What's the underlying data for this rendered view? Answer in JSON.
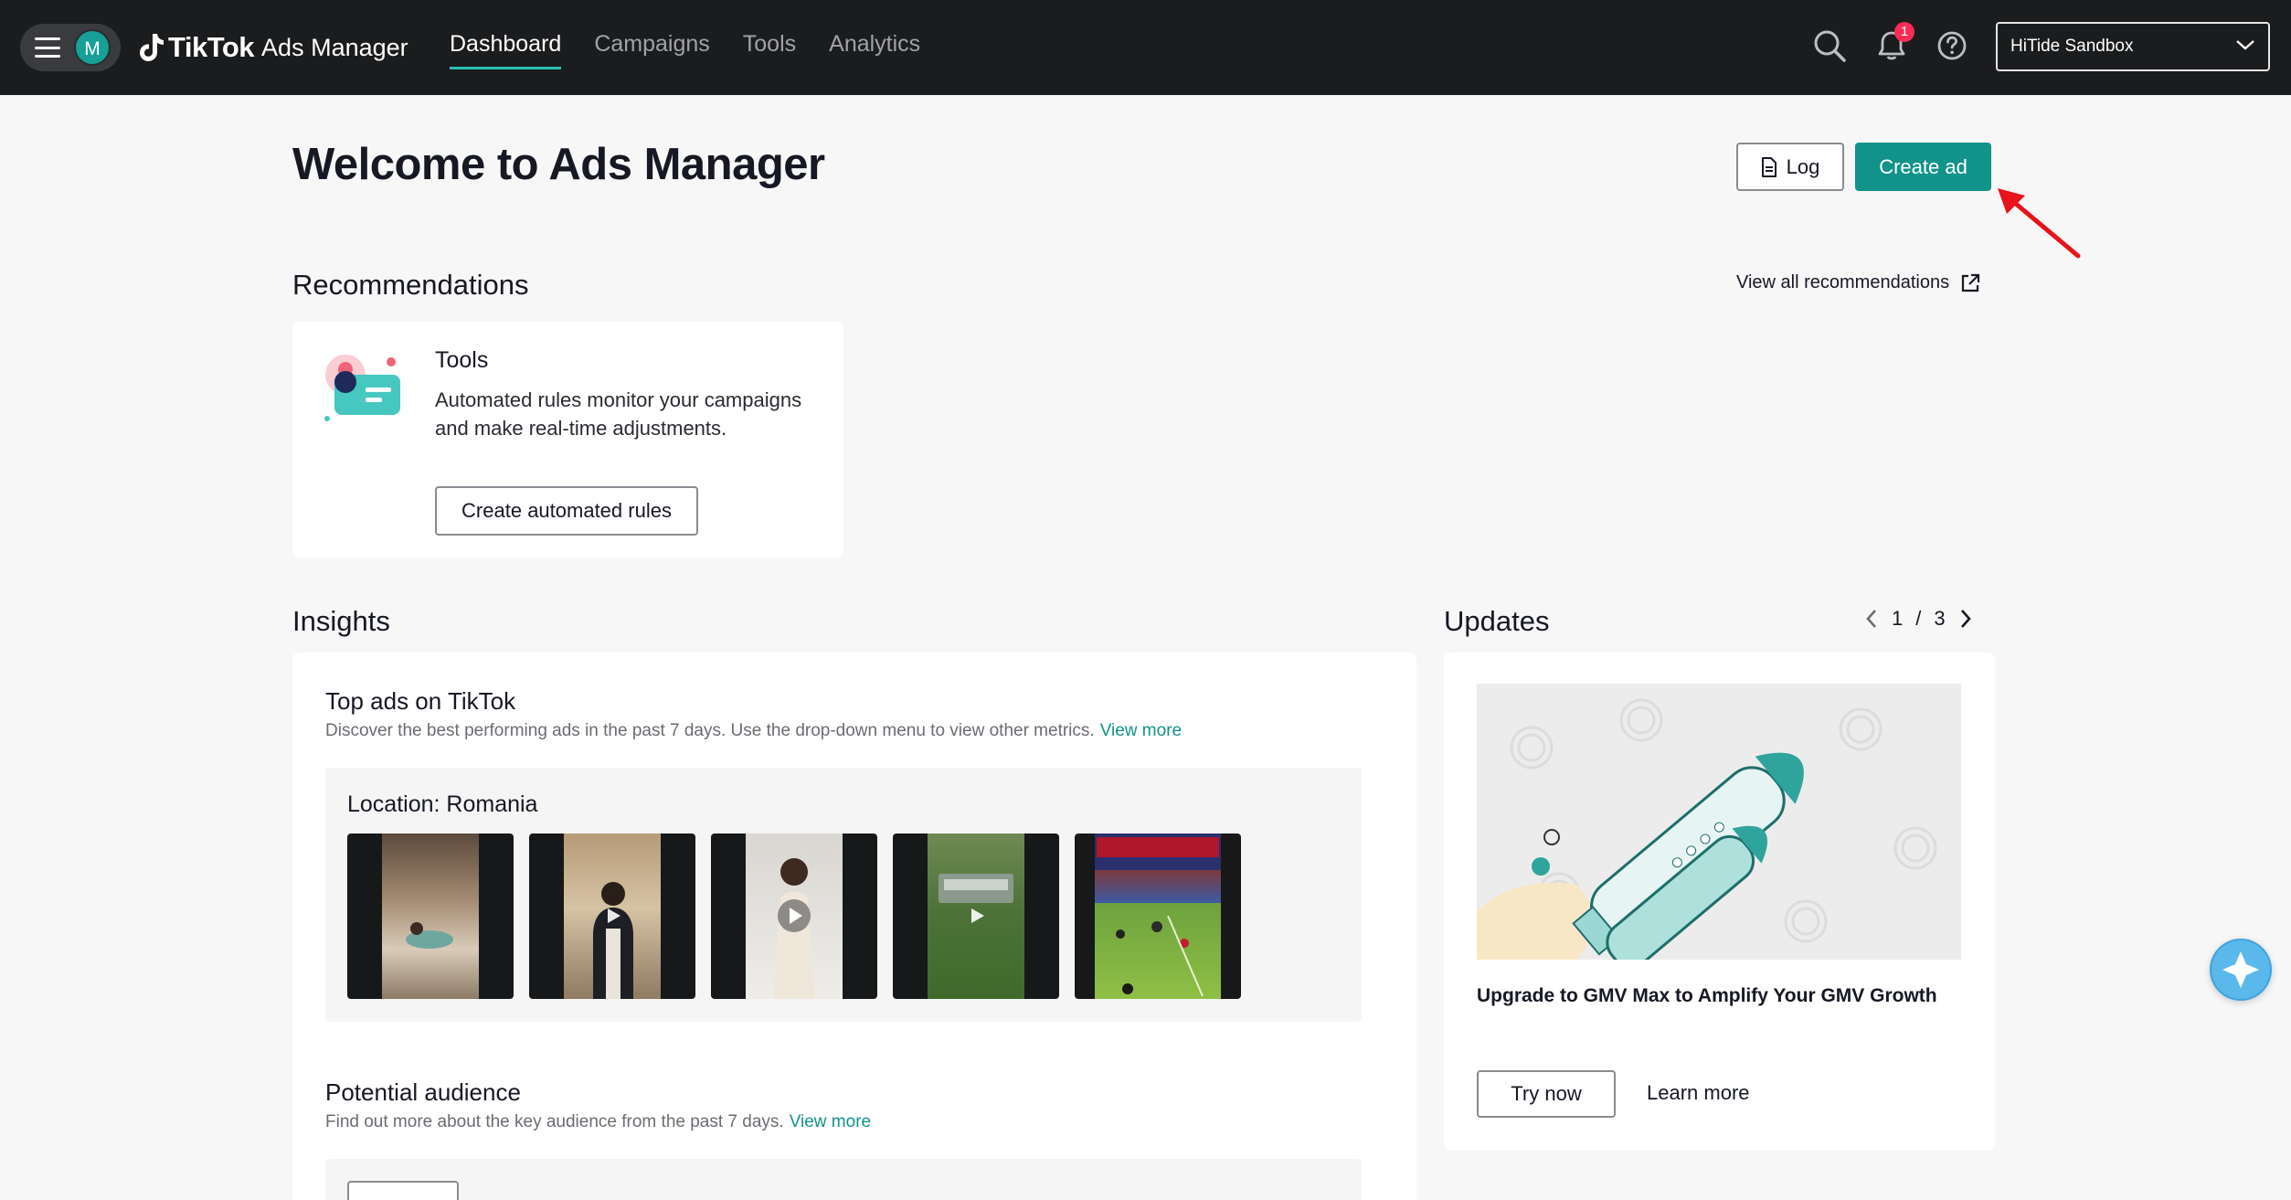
{
  "topbar": {
    "avatar_initial": "M",
    "brand": "TikTok",
    "brand_sub": "Ads Manager",
    "nav": [
      {
        "label": "Dashboard",
        "active": true
      },
      {
        "label": "Campaigns",
        "active": false
      },
      {
        "label": "Tools",
        "active": false
      },
      {
        "label": "Analytics",
        "active": false
      }
    ],
    "notifications_count": "1",
    "account": "HiTide Sandbox"
  },
  "header": {
    "title": "Welcome to Ads Manager",
    "log_label": "Log",
    "create_ad_label": "Create ad"
  },
  "recommendations": {
    "title": "Recommendations",
    "view_all": "View all recommendations",
    "card": {
      "title": "Tools",
      "description": "Automated rules monitor your campaigns and make real-time adjustments.",
      "button": "Create automated rules"
    }
  },
  "insights": {
    "title": "Insights",
    "top_ads": {
      "title": "Top ads on TikTok",
      "description": "Discover the best performing ads in the past 7 days. Use the drop-down menu to view other metrics.",
      "view_more": "View more",
      "location": "Location: Romania",
      "thumbnails": [
        "video-thumbnail-1",
        "video-thumbnail-2",
        "video-thumbnail-3",
        "video-thumbnail-4",
        "video-thumbnail-5"
      ]
    },
    "audience": {
      "title": "Potential audience",
      "description": "Find out more about the key audience from the past 7 days.",
      "view_more": "View more"
    }
  },
  "updates": {
    "title": "Updates",
    "page_current": "1",
    "page_sep": "/",
    "page_total": "3",
    "card": {
      "title": "Upgrade to GMV Max to Amplify Your GMV Growth",
      "try_now": "Try now",
      "learn_more": "Learn more"
    }
  },
  "colors": {
    "accent": "#11938a",
    "topbar": "#1b1c1e",
    "badge": "#fe2c55",
    "annotation_arrow": "#e8131b"
  }
}
